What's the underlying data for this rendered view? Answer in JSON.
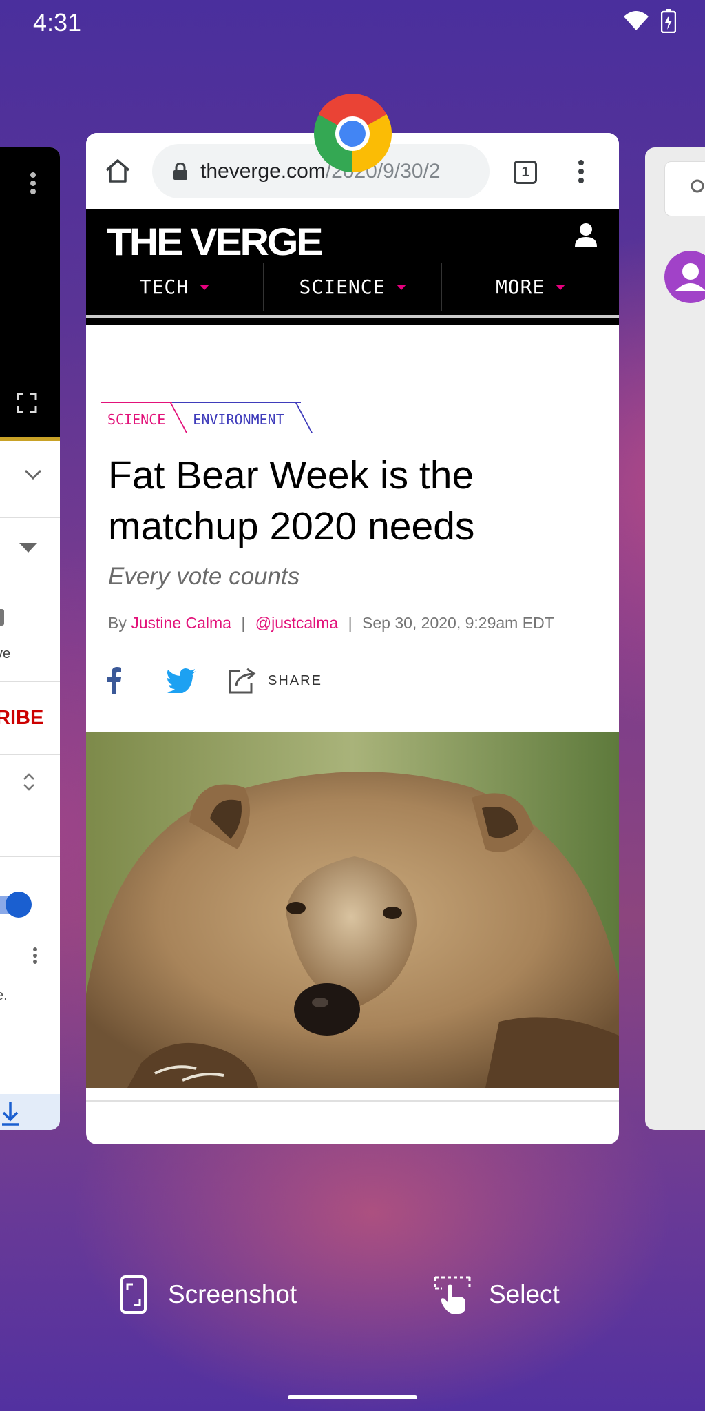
{
  "status_bar": {
    "time": "4:31",
    "icons": [
      "wifi-icon",
      "battery-charging-icon"
    ]
  },
  "chrome": {
    "url_host": "theverge.com",
    "url_path": "/2020/9/30/2",
    "tab_count": "1"
  },
  "verge": {
    "logo": "THE VERGE",
    "nav": [
      {
        "label": "TECH"
      },
      {
        "label": "SCIENCE"
      },
      {
        "label": "MORE"
      }
    ],
    "tags": [
      "SCIENCE",
      "ENVIRONMENT"
    ],
    "headline": "Fat Bear Week is the matchup 2020 needs",
    "dek": "Every vote counts",
    "byline": {
      "prefix": "By",
      "author": "Justine Calma",
      "handle": "@justcalma",
      "date": "Sep 30, 2020, 9:29am EDT"
    },
    "share_label": "SHARE"
  },
  "left_card": {
    "partial_text_1": "ve",
    "partial_text_2": "RIBE",
    "partial_text_3": "e."
  },
  "actions": {
    "screenshot_label": "Screenshot",
    "select_label": "Select"
  },
  "colors": {
    "verge_pink": "#e2127a",
    "verge_purple": "#3f3cbb",
    "twitter_blue": "#1da1f2",
    "facebook_blue": "#3b5998"
  }
}
